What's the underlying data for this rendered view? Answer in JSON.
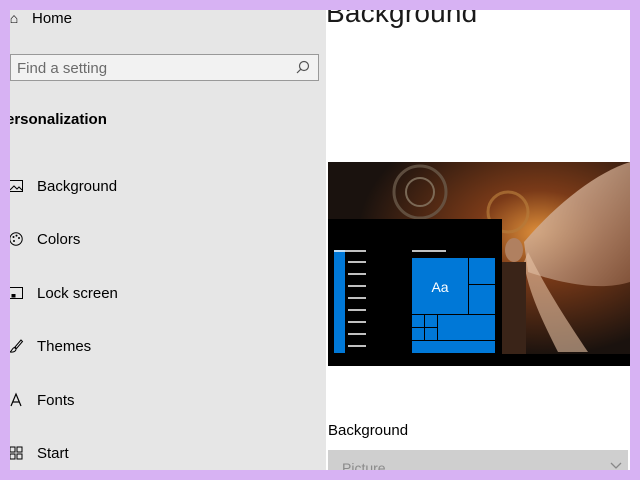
{
  "sidebar": {
    "home_label": "Home",
    "search_placeholder": "Find a setting",
    "section_title": "ersonalization",
    "items": [
      {
        "label": "Background",
        "icon": "picture-icon"
      },
      {
        "label": "Colors",
        "icon": "palette-icon"
      },
      {
        "label": "Lock screen",
        "icon": "lock-screen-icon"
      },
      {
        "label": "Themes",
        "icon": "brush-icon"
      },
      {
        "label": "Fonts",
        "icon": "font-icon"
      },
      {
        "label": "Start",
        "icon": "start-icon"
      }
    ]
  },
  "main": {
    "title": "Background",
    "preview_sample_text": "Aa",
    "background_label": "Background",
    "background_value": "Picture"
  },
  "colors": {
    "frame_border": "#d7b2f3",
    "sidebar_bg": "#e6e6e6",
    "accent": "#0078d7"
  }
}
